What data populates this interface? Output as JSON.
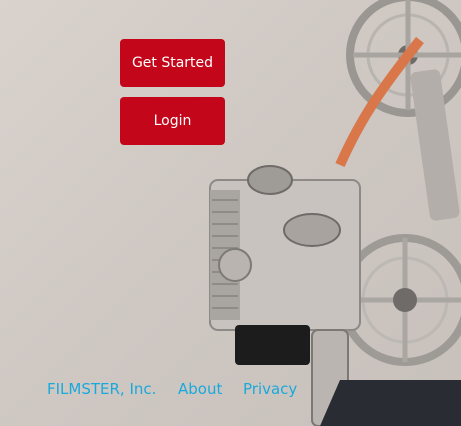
{
  "buttons": {
    "get_started": "Get Started",
    "login": "Login"
  },
  "footer": {
    "company": "FILMSTER, Inc.",
    "about": "About",
    "privacy": "Privacy"
  },
  "colors": {
    "button_bg": "#c4061a",
    "link": "#1aa9dc"
  },
  "background_image": "vintage-film-projector"
}
